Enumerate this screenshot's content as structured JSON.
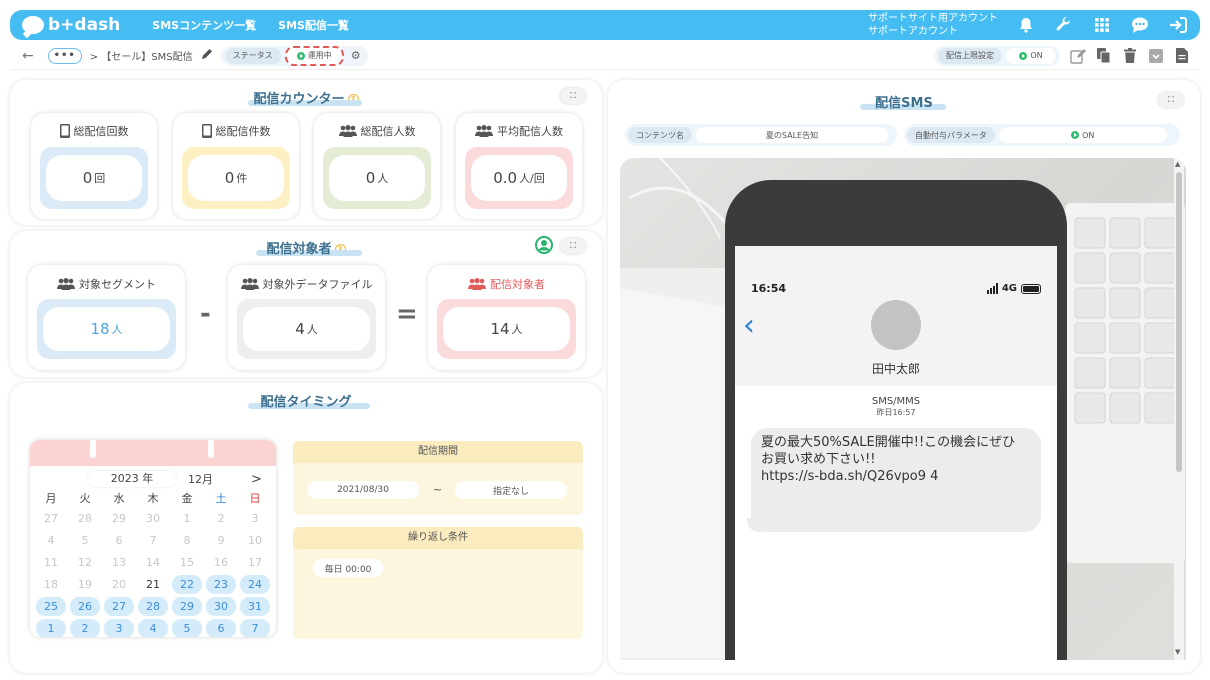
{
  "header": {
    "logo_text": "b+dash",
    "nav": [
      "SMSコンテンツ一覧",
      "SMS配信一覧"
    ],
    "account_line1": "サポートサイト用アカウント",
    "account_line2": "サポートアカウント",
    "icons": [
      "bell-icon",
      "wrench-icon",
      "apps-grid-icon",
      "chat-icon",
      "logout-icon"
    ],
    "brand_color": "#45bdf3"
  },
  "toolbar": {
    "more": "•••",
    "crumb": "> 【セール】SMS配信",
    "status_label": "ステータス",
    "status_value": "運用中",
    "limit_label": "配信上限設定",
    "limit_value": "ON"
  },
  "counter": {
    "title": "配信カウンター",
    "cards": [
      {
        "label": "総配信回数",
        "value": "0",
        "unit": "回",
        "icon": "mobile-icon",
        "color": "#dbeaf7"
      },
      {
        "label": "総配信件数",
        "value": "0",
        "unit": "件",
        "icon": "mobile-icon",
        "color": "#fdf0c2"
      },
      {
        "label": "総配信人数",
        "value": "0",
        "unit": "人",
        "icon": "users-icon",
        "color": "#e5ecd6"
      },
      {
        "label": "平均配信人数",
        "value": "0.0",
        "unit": "人/回",
        "icon": "users-icon",
        "color": "#fadadb"
      }
    ]
  },
  "audience": {
    "title": "配信対象者",
    "minus": "-",
    "equals": "=",
    "segment": {
      "label": "対象セグメント",
      "value": "18",
      "unit": "人"
    },
    "excluded": {
      "label": "対象外データファイル",
      "value": "4",
      "unit": "人"
    },
    "target": {
      "label": "配信対象者",
      "value": "14",
      "unit": "人"
    }
  },
  "timing": {
    "title": "配信タイミング",
    "calendar": {
      "year": "2023 年",
      "month": "12月",
      "next": ">",
      "weekdays": [
        "月",
        "火",
        "水",
        "木",
        "金",
        "土",
        "日"
      ],
      "days": [
        "27",
        "28",
        "29",
        "30",
        "1",
        "2",
        "3",
        "4",
        "5",
        "6",
        "7",
        "8",
        "9",
        "10",
        "11",
        "12",
        "13",
        "14",
        "15",
        "16",
        "17",
        "18",
        "19",
        "20",
        "21",
        "22",
        "23",
        "24",
        "25",
        "26",
        "27",
        "28",
        "29",
        "30",
        "31",
        "1",
        "2",
        "3",
        "4",
        "5",
        "6",
        "7"
      ],
      "current_day_index": 24,
      "active_from_index": 25
    },
    "period_title": "配信期間",
    "period_start": "2021/08/30",
    "period_sep": "~",
    "period_end": "指定なし",
    "repeat_title": "繰り返し条件",
    "repeat_value": "毎日 00:00"
  },
  "sms": {
    "title": "配信SMS",
    "content_label": "コンテンツ名",
    "content_value": "夏のSALE告知",
    "param_label": "自動付与パラメータ",
    "param_value": "ON",
    "phone": {
      "time": "16:54",
      "network": "4G",
      "contact": "田中太郎",
      "channel": "SMS/MMS",
      "sent_time": "昨日16:57",
      "message_line1": "夏の最大50%SALE開催中!!この機会にぜひ",
      "message_line2": "お買い求め下さい!!",
      "message_line3": "https://s-bda.sh/Q26vpo9 4"
    }
  }
}
